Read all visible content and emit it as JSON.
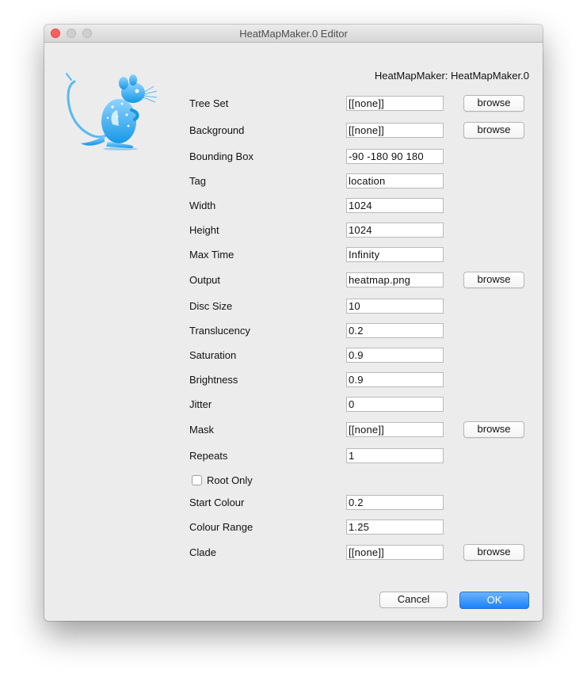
{
  "window": {
    "title": "HeatMapMaker.0 Editor"
  },
  "header": {
    "label": "HeatMapMaker: HeatMapMaker.0"
  },
  "logo": {
    "icon": "kangaroo-rat-icon",
    "color": "#2aa2e8"
  },
  "fields": {
    "tree_set": {
      "label": "Tree Set",
      "value": "[[none]]",
      "browse": "browse"
    },
    "background": {
      "label": "Background",
      "value": "[[none]]",
      "browse": "browse"
    },
    "bounding_box": {
      "label": "Bounding Box",
      "value": "-90 -180 90 180"
    },
    "tag": {
      "label": "Tag",
      "value": "location"
    },
    "width": {
      "label": "Width",
      "value": "1024"
    },
    "height": {
      "label": "Height",
      "value": "1024"
    },
    "max_time": {
      "label": "Max Time",
      "value": "Infinity"
    },
    "output": {
      "label": "Output",
      "value": "heatmap.png",
      "browse": "browse"
    },
    "disc_size": {
      "label": "Disc Size",
      "value": "10"
    },
    "translucency": {
      "label": "Translucency",
      "value": "0.2"
    },
    "saturation": {
      "label": "Saturation",
      "value": "0.9"
    },
    "brightness": {
      "label": "Brightness",
      "value": "0.9"
    },
    "jitter": {
      "label": "Jitter",
      "value": "0"
    },
    "mask": {
      "label": "Mask",
      "value": "[[none]]",
      "browse": "browse"
    },
    "repeats": {
      "label": "Repeats",
      "value": "1"
    },
    "root_only": {
      "label": "Root Only",
      "checked": false
    },
    "start_colour": {
      "label": "Start Colour",
      "value": "0.2"
    },
    "colour_range": {
      "label": "Colour Range",
      "value": "1.25"
    },
    "clade": {
      "label": "Clade",
      "value": "[[none]]",
      "browse": "browse"
    }
  },
  "buttons": {
    "cancel": "Cancel",
    "ok": "OK"
  }
}
